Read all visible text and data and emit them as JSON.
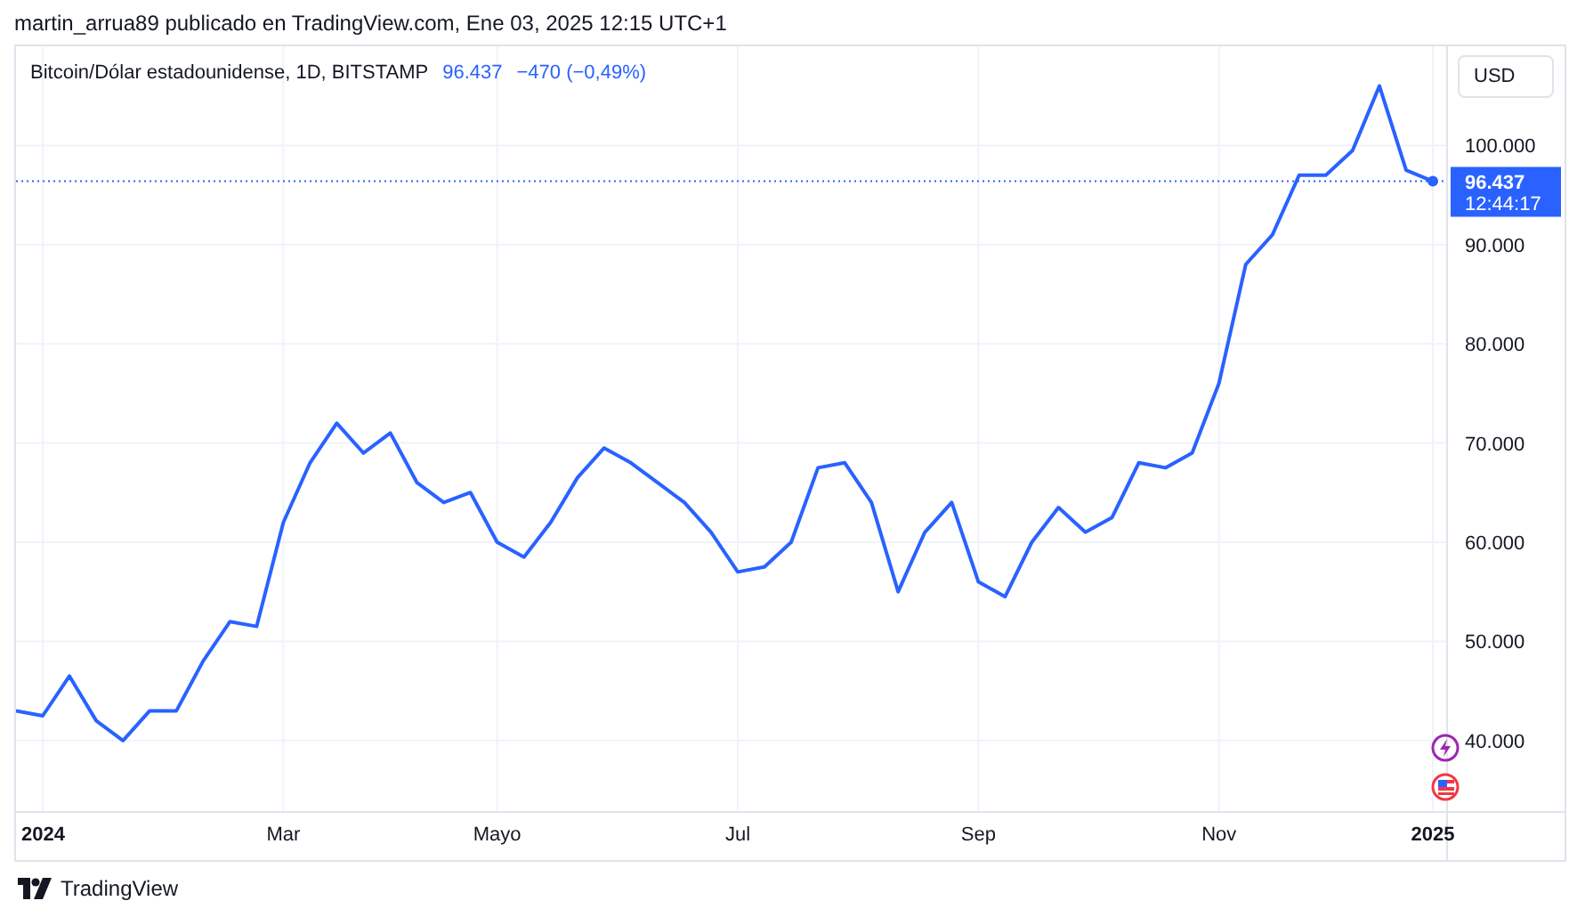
{
  "header": {
    "text": "martin_arrua89 publicado en TradingView.com, Ene 03, 2025 12:15 UTC+1"
  },
  "legend": {
    "symbol": "Bitcoin/Dólar estadounidense, 1D, BITSTAMP",
    "price": "96.437",
    "change": "−470 (−0,49%)"
  },
  "currency_button": "USD",
  "price_label": {
    "price": "96.437",
    "countdown": "12:44:17"
  },
  "chart_data": {
    "type": "line",
    "categories": [
      null,
      "2024",
      null,
      null,
      null,
      null,
      null,
      null,
      null,
      null,
      "Mar",
      null,
      null,
      null,
      null,
      null,
      null,
      null,
      "Mayo",
      null,
      null,
      null,
      null,
      null,
      null,
      null,
      null,
      "Jul",
      null,
      null,
      null,
      null,
      null,
      null,
      null,
      null,
      "Sep",
      null,
      null,
      null,
      null,
      null,
      null,
      null,
      null,
      "Nov",
      null,
      null,
      null,
      null,
      null,
      null,
      null,
      "2025"
    ],
    "series": [
      {
        "color": "#2962ff",
        "values": [
          43000,
          42500,
          46500,
          42000,
          40000,
          43000,
          43000,
          48000,
          52000,
          51500,
          62000,
          68000,
          72000,
          69000,
          71000,
          66000,
          64000,
          65000,
          60000,
          58500,
          62000,
          66500,
          69500,
          68000,
          66000,
          64000,
          61000,
          57000,
          57500,
          60000,
          67500,
          68000,
          64000,
          55000,
          61000,
          64000,
          56000,
          54500,
          60000,
          63500,
          61000,
          62500,
          68000,
          67500,
          69000,
          76000,
          88000,
          91000,
          97000,
          97000,
          99500,
          106000,
          97500,
          96400
        ]
      }
    ],
    "ylim": [
      32800,
      110000
    ],
    "grid": true,
    "ref_lines": [
      {
        "axis": "y",
        "value": 96400,
        "color": "#2962ff"
      }
    ],
    "yticks": [
      {
        "value": 40000,
        "label": "40.000"
      },
      {
        "value": 50000,
        "label": "50.000"
      },
      {
        "value": 60000,
        "label": "60.000"
      },
      {
        "value": 70000,
        "label": "70.000"
      },
      {
        "value": 80000,
        "label": "80.000"
      },
      {
        "value": 90000,
        "label": "90.000"
      },
      {
        "value": 100000,
        "label": "100.000"
      }
    ]
  },
  "footer": {
    "brand": "TradingView"
  }
}
